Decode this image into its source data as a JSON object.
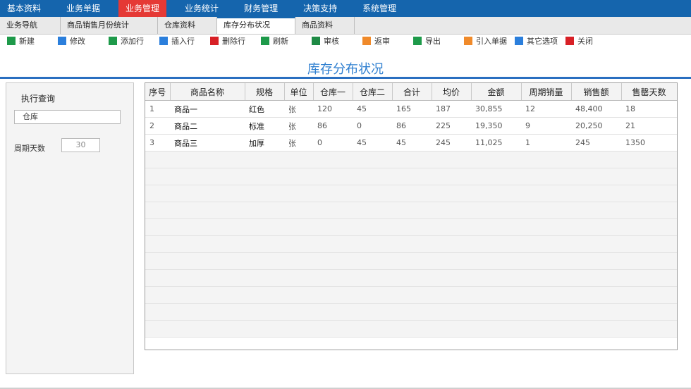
{
  "menu": [
    "基本资料",
    "业务单据",
    "业务管理",
    "业务统计",
    "财务管理",
    "决策支持",
    "系统管理"
  ],
  "tabs": [
    "业务导航",
    "商品销售月份统计",
    "仓库资料",
    "库存分布状况",
    "商品资料"
  ],
  "toolbar": [
    {
      "label": "新建",
      "color": "#1e9a4a"
    },
    {
      "label": "修改",
      "color": "#2b7fdc"
    },
    {
      "label": "添加行",
      "color": "#1e9a4a"
    },
    {
      "label": "插入行",
      "color": "#2b7fdc"
    },
    {
      "label": "删除行",
      "color": "#d82026"
    },
    {
      "label": "刷新",
      "color": "#1e9a4a"
    },
    {
      "label": "审核",
      "color": "#1e8a45"
    },
    {
      "label": "返审",
      "color": "#f08a2a"
    },
    {
      "label": "导出",
      "color": "#1e9a4a"
    },
    {
      "label": "引入单据",
      "color": "#f08a2a"
    },
    {
      "label": "其它选项",
      "color": "#2b7fdc"
    },
    {
      "label": "关闭",
      "color": "#d82026"
    }
  ],
  "page_title": "库存分布状况",
  "query": {
    "button_label": "执行查询",
    "warehouse_value": "仓库",
    "cycle_days_label": "周期天数",
    "cycle_days_value": "30"
  },
  "grid": {
    "columns": [
      "序号",
      "商品名称",
      "规格",
      "单位",
      "仓库一",
      "仓库二",
      "合计",
      "均价",
      "金额",
      "周期销量",
      "销售额",
      "售罄天数"
    ],
    "rows": [
      [
        "1",
        "商品一",
        "红色",
        "张",
        "120",
        "45",
        "165",
        "187",
        "30,855",
        "12",
        "48,400",
        "18"
      ],
      [
        "2",
        "商品二",
        "标准",
        "张",
        "86",
        "0",
        "86",
        "225",
        "19,350",
        "9",
        "20,250",
        "21"
      ],
      [
        "3",
        "商品三",
        "加厚",
        "张",
        "0",
        "45",
        "45",
        "245",
        "11,025",
        "1",
        "245",
        "1350"
      ]
    ]
  }
}
